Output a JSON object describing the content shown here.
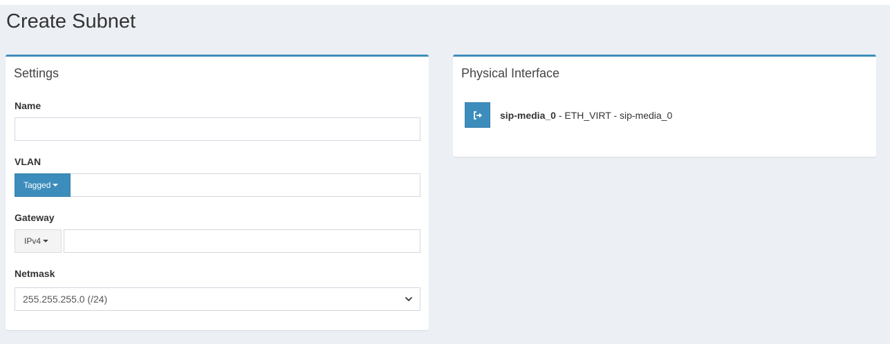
{
  "page": {
    "title": "Create Subnet"
  },
  "settings": {
    "title": "Settings",
    "name": {
      "label": "Name",
      "value": ""
    },
    "vlan": {
      "label": "VLAN",
      "mode_button": "Tagged",
      "value": ""
    },
    "gateway": {
      "label": "Gateway",
      "family_button": "IPv4",
      "value": ""
    },
    "netmask": {
      "label": "Netmask",
      "selected": "255.255.255.0 (/24)"
    }
  },
  "physical_interface": {
    "title": "Physical Interface",
    "item": {
      "name": "sip-media_0",
      "details": " - ETH_VIRT - sip-media_0",
      "icon": "sign-out-icon"
    }
  },
  "colors": {
    "primary": "#3c8dbc",
    "background": "#ecf0f5",
    "box_border_top": "#3c8dbc"
  }
}
